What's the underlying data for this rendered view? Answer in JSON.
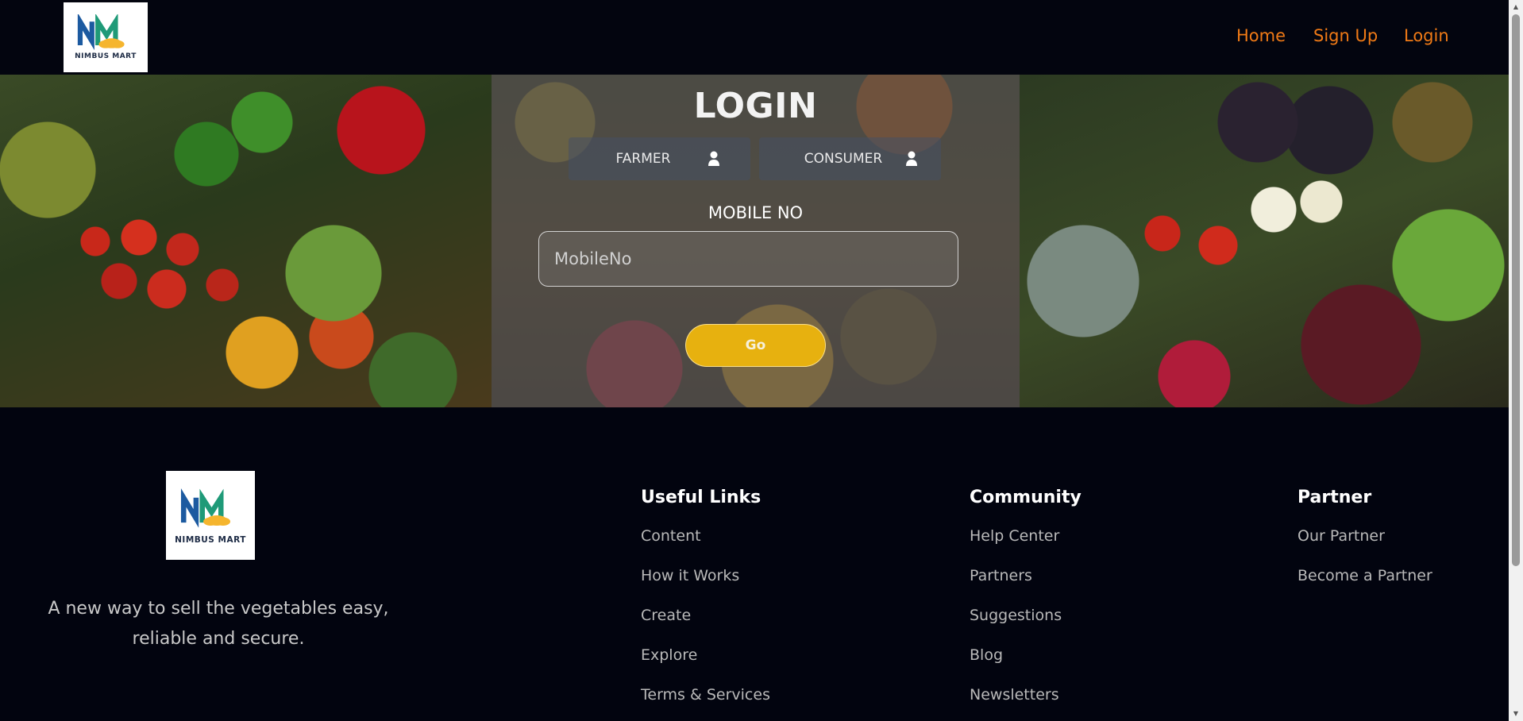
{
  "header": {
    "logo_text": "NIMBUS MART",
    "nav": {
      "home": "Home",
      "signup": "Sign Up",
      "login": "Login"
    }
  },
  "login": {
    "title": "LOGIN",
    "roles": {
      "farmer": "FARMER",
      "consumer": "CONSUMER"
    },
    "mobile_label": "MOBILE NO",
    "mobile_placeholder": "MobileNo",
    "mobile_value": "",
    "go_label": "Go"
  },
  "footer": {
    "logo_text": "NIMBUS MART",
    "tagline": "A new way to sell the vegetables easy, reliable and secure.",
    "useful_links": {
      "title": "Useful Links",
      "items": [
        "Content",
        "How it Works",
        "Create",
        "Explore",
        "Terms & Services"
      ]
    },
    "community": {
      "title": "Community",
      "items": [
        "Help Center",
        "Partners",
        "Suggestions",
        "Blog",
        "Newsletters"
      ]
    },
    "partner": {
      "title": "Partner",
      "items": [
        "Our Partner",
        "Become a Partner"
      ]
    }
  },
  "colors": {
    "nav_link": "#f07a16",
    "go_button": "#e7b10f",
    "background": "#02040f",
    "logo_green": "#1f9a78",
    "logo_blue": "#1c5aa0",
    "logo_cloud": "#f5b52e"
  },
  "icons": {
    "role_icon": "person-icon",
    "logo": "nimbus-mart-logo"
  }
}
